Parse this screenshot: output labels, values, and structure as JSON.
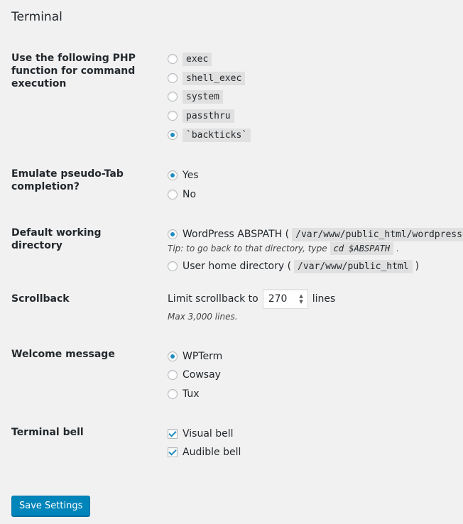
{
  "page_title": "Terminal",
  "php_function": {
    "label": "Use the following PHP function for command execution",
    "options": [
      "exec",
      "shell_exec",
      "system",
      "passthru",
      "`backticks`"
    ],
    "selected": "`backticks`"
  },
  "tab_completion": {
    "label": "Emulate pseudo-Tab completion?",
    "options": [
      "Yes",
      "No"
    ],
    "selected": "Yes"
  },
  "working_directory": {
    "label": "Default working directory",
    "abspath_label": "WordPress ABSPATH (",
    "abspath_value": "/var/www/public_html/wordpress",
    "tip_prefix": "Tip: to go back to that directory, type",
    "tip_command": "cd $ABSPATH",
    "tip_suffix": ".",
    "home_label": "User home directory (",
    "home_value": "/var/www/public_html",
    "home_suffix": ")",
    "selected": "abspath"
  },
  "scrollback": {
    "label": "Scrollback",
    "prefix": "Limit scrollback to",
    "value": "270",
    "suffix": "lines",
    "hint": "Max 3,000 lines."
  },
  "welcome_message": {
    "label": "Welcome message",
    "options": [
      "WPTerm",
      "Cowsay",
      "Tux"
    ],
    "selected": "WPTerm"
  },
  "terminal_bell": {
    "label": "Terminal bell",
    "visual": "Visual bell",
    "audible": "Audible bell",
    "visual_checked": true,
    "audible_checked": true
  },
  "save_button": "Save Settings",
  "colors": {
    "accent": "#1e8cbe",
    "button": "#0085ba",
    "background": "#f1f1f1"
  }
}
